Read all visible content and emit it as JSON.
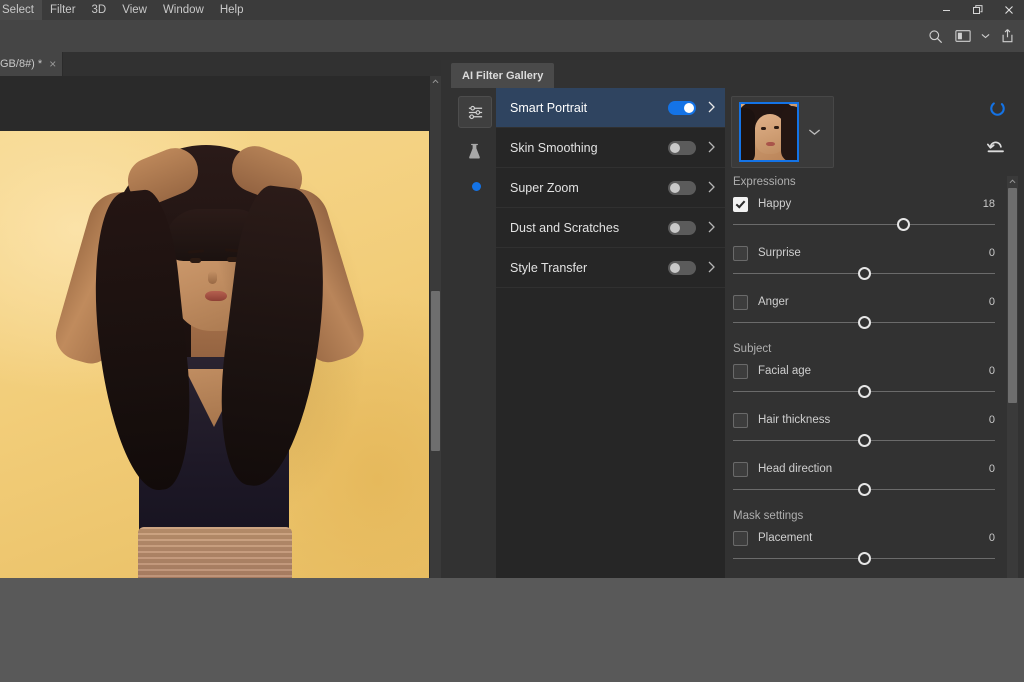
{
  "menu": {
    "items": [
      {
        "label": "Select"
      },
      {
        "label": "Filter"
      },
      {
        "label": "3D"
      },
      {
        "label": "View"
      },
      {
        "label": "Window"
      },
      {
        "label": "Help"
      }
    ]
  },
  "window_controls": {
    "minimize": "minimize-icon",
    "restore": "restore-icon",
    "close": "close-icon"
  },
  "options_bar": {
    "search": "search-icon",
    "workspace": "workspace-icon",
    "workspace_chevron": "chevron-down-icon",
    "share": "share-icon",
    "overflow": "»"
  },
  "document_tab": {
    "label": "GB/8#) *",
    "close": "×"
  },
  "panel": {
    "tab_label": "AI Filter Gallery",
    "rail": [
      {
        "name": "sliders-icon",
        "selected": true
      },
      {
        "name": "beaker-icon",
        "selected": false
      },
      {
        "name": "status-dot-icon",
        "selected": false
      }
    ],
    "filters": [
      {
        "label": "Smart Portrait",
        "enabled": true,
        "active": true
      },
      {
        "label": "Skin Smoothing",
        "enabled": false,
        "active": false
      },
      {
        "label": "Super Zoom",
        "enabled": false,
        "active": false
      },
      {
        "label": "Dust and Scratches",
        "enabled": false,
        "active": false
      },
      {
        "label": "Style Transfer",
        "enabled": false,
        "active": false
      }
    ],
    "settings": {
      "thumbnail_chevron": "chevron-down-icon",
      "spinner": "loading-spinner-icon",
      "reset": "reset-icon",
      "sections": [
        {
          "title": "Expressions",
          "controls": [
            {
              "label": "Happy",
              "value": "18",
              "checked": true,
              "pos": 65
            },
            {
              "label": "Surprise",
              "value": "0",
              "checked": false,
              "pos": 50
            },
            {
              "label": "Anger",
              "value": "0",
              "checked": false,
              "pos": 50
            }
          ]
        },
        {
          "title": "Subject",
          "controls": [
            {
              "label": "Facial age",
              "value": "0",
              "checked": false,
              "pos": 50
            },
            {
              "label": "Hair thickness",
              "value": "0",
              "checked": false,
              "pos": 50
            },
            {
              "label": "Head direction",
              "value": "0",
              "checked": false,
              "pos": 50
            }
          ]
        },
        {
          "title": "Mask settings",
          "controls": [
            {
              "label": "Placement",
              "value": "0",
              "checked": false,
              "pos": 50
            }
          ]
        }
      ]
    }
  },
  "colors": {
    "accent": "#1473e6",
    "panel_bg": "#323232",
    "list_bg": "#262626",
    "active_row": "#2f4460",
    "canvas_bg": "#2a2a2a",
    "artboard": "#f2cd79"
  }
}
